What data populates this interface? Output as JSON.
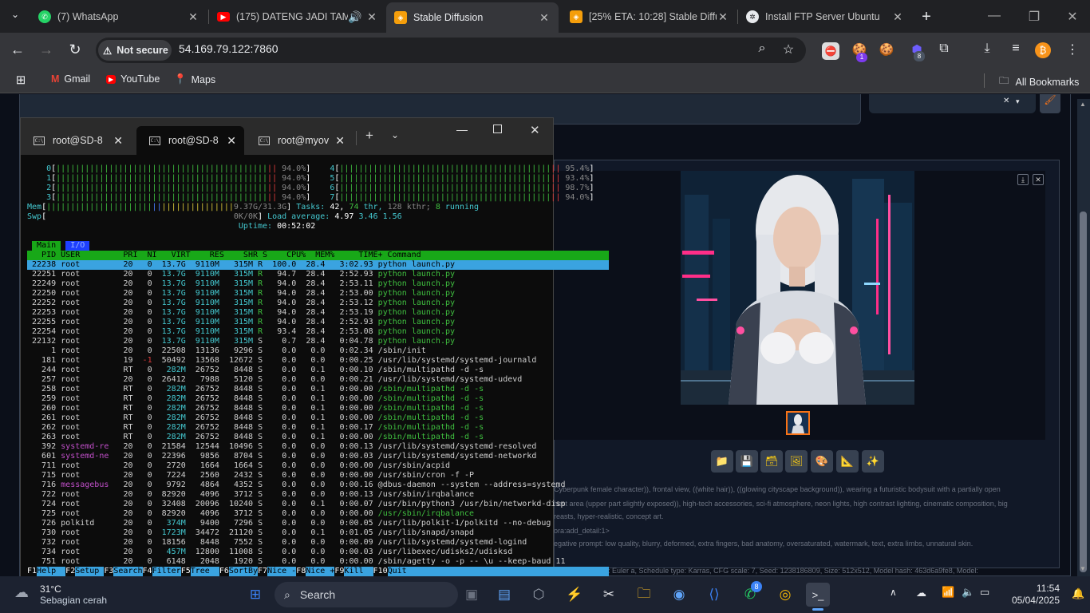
{
  "browser": {
    "tabs": [
      {
        "title": "(7) WhatsApp",
        "icon": "whatsapp-icon",
        "active": false
      },
      {
        "title": "(175) DATENG JADI TAMU",
        "icon": "youtube-icon",
        "active": false
      },
      {
        "title": "Stable Diffusion",
        "icon": "stable-diffusion-icon",
        "active": true
      },
      {
        "title": "[25% ETA: 10:28] Stable Diffu",
        "icon": "stable-diffusion-icon",
        "active": false
      },
      {
        "title": "Install FTP Server Ubuntu",
        "icon": "chatgpt-icon",
        "active": false
      }
    ],
    "security_label": "Not secure",
    "url": "54.169.79.122:7860",
    "bookmarks": [
      "Gmail",
      "YouTube",
      "Maps"
    ],
    "all_bookmarks_label": "All Bookmarks",
    "extension_badges": {
      "ext1": "1",
      "ext2": "8"
    }
  },
  "terminal": {
    "tabs": [
      "root@SD-8",
      "root@SD-8",
      "root@myov"
    ],
    "active_tab": 1,
    "htop": {
      "cpus": [
        {
          "id": "0",
          "pct": "94.0%"
        },
        {
          "id": "1",
          "pct": "94.0%"
        },
        {
          "id": "2",
          "pct": "94.0%"
        },
        {
          "id": "3",
          "pct": "94.0%"
        },
        {
          "id": "4",
          "pct": "95.4%"
        },
        {
          "id": "5",
          "pct": "93.4%"
        },
        {
          "id": "6",
          "pct": "98.7%"
        },
        {
          "id": "7",
          "pct": "94.0%"
        }
      ],
      "mem": "9.37G/31.3G",
      "swp": "0K/0K",
      "tasks_label": "Tasks:",
      "tasks": "42,",
      "thr": "74",
      "thr_label": "thr,",
      "kthr": "128 kthr;",
      "running": "8",
      "running_label": "running",
      "load_label": "Load average:",
      "load1": "4.97",
      "load5": "3.46",
      "load15": "1.56",
      "uptime_label": "Uptime:",
      "uptime": "00:52:02",
      "view_tabs": [
        "Main",
        "I/O"
      ],
      "columns": [
        "PID",
        "USER",
        "PRI",
        "NI",
        "VIRT",
        "RES",
        "SHR",
        "S",
        "CPU%",
        "MEM%",
        "TIME+",
        "Command"
      ],
      "processes": [
        [
          "22238",
          "root",
          "20",
          "0",
          "13.7G",
          "9110M",
          "315M",
          "R",
          "100.0",
          "28.4",
          "3:02.93",
          "python launch.py"
        ],
        [
          "22251",
          "root",
          "20",
          "0",
          "13.7G",
          "9110M",
          "315M",
          "R",
          "94.7",
          "28.4",
          "2:52.93",
          "python launch.py"
        ],
        [
          "22249",
          "root",
          "20",
          "0",
          "13.7G",
          "9110M",
          "315M",
          "R",
          "94.0",
          "28.4",
          "2:53.11",
          "python launch.py"
        ],
        [
          "22250",
          "root",
          "20",
          "0",
          "13.7G",
          "9110M",
          "315M",
          "R",
          "94.0",
          "28.4",
          "2:53.00",
          "python launch.py"
        ],
        [
          "22252",
          "root",
          "20",
          "0",
          "13.7G",
          "9110M",
          "315M",
          "R",
          "94.0",
          "28.4",
          "2:53.12",
          "python launch.py"
        ],
        [
          "22253",
          "root",
          "20",
          "0",
          "13.7G",
          "9110M",
          "315M",
          "R",
          "94.0",
          "28.4",
          "2:53.19",
          "python launch.py"
        ],
        [
          "22255",
          "root",
          "20",
          "0",
          "13.7G",
          "9110M",
          "315M",
          "R",
          "94.0",
          "28.4",
          "2:52.93",
          "python launch.py"
        ],
        [
          "22254",
          "root",
          "20",
          "0",
          "13.7G",
          "9110M",
          "315M",
          "R",
          "93.4",
          "28.4",
          "2:53.08",
          "python launch.py"
        ],
        [
          "22132",
          "root",
          "20",
          "0",
          "13.7G",
          "9110M",
          "315M",
          "S",
          "0.7",
          "28.4",
          "0:04.78",
          "python launch.py"
        ],
        [
          "1",
          "root",
          "20",
          "0",
          "22508",
          "13136",
          "9296",
          "S",
          "0.0",
          "0.0",
          "0:02.34",
          "/sbin/init"
        ],
        [
          "181",
          "root",
          "19",
          "-1",
          "50492",
          "13568",
          "12672",
          "S",
          "0.0",
          "0.0",
          "0:00.25",
          "/usr/lib/systemd/systemd-journald"
        ],
        [
          "244",
          "root",
          "RT",
          "0",
          "282M",
          "26752",
          "8448",
          "S",
          "0.0",
          "0.1",
          "0:00.10",
          "/sbin/multipathd -d -s"
        ],
        [
          "257",
          "root",
          "20",
          "0",
          "26412",
          "7988",
          "5120",
          "S",
          "0.0",
          "0.0",
          "0:00.21",
          "/usr/lib/systemd/systemd-udevd"
        ],
        [
          "258",
          "root",
          "RT",
          "0",
          "282M",
          "26752",
          "8448",
          "S",
          "0.0",
          "0.1",
          "0:00.00",
          "/sbin/multipathd -d -s"
        ],
        [
          "259",
          "root",
          "RT",
          "0",
          "282M",
          "26752",
          "8448",
          "S",
          "0.0",
          "0.1",
          "0:00.00",
          "/sbin/multipathd -d -s"
        ],
        [
          "260",
          "root",
          "RT",
          "0",
          "282M",
          "26752",
          "8448",
          "S",
          "0.0",
          "0.1",
          "0:00.00",
          "/sbin/multipathd -d -s"
        ],
        [
          "261",
          "root",
          "RT",
          "0",
          "282M",
          "26752",
          "8448",
          "S",
          "0.0",
          "0.1",
          "0:00.00",
          "/sbin/multipathd -d -s"
        ],
        [
          "262",
          "root",
          "RT",
          "0",
          "282M",
          "26752",
          "8448",
          "S",
          "0.0",
          "0.1",
          "0:00.17",
          "/sbin/multipathd -d -s"
        ],
        [
          "263",
          "root",
          "RT",
          "0",
          "282M",
          "26752",
          "8448",
          "S",
          "0.0",
          "0.1",
          "0:00.00",
          "/sbin/multipathd -d -s"
        ],
        [
          "392",
          "systemd-re",
          "20",
          "0",
          "21584",
          "12544",
          "10496",
          "S",
          "0.0",
          "0.0",
          "0:00.13",
          "/usr/lib/systemd/systemd-resolved"
        ],
        [
          "601",
          "systemd-ne",
          "20",
          "0",
          "22396",
          "9856",
          "8704",
          "S",
          "0.0",
          "0.0",
          "0:00.03",
          "/usr/lib/systemd/systemd-networkd"
        ],
        [
          "711",
          "root",
          "20",
          "0",
          "2720",
          "1664",
          "1664",
          "S",
          "0.0",
          "0.0",
          "0:00.00",
          "/usr/sbin/acpid"
        ],
        [
          "715",
          "root",
          "20",
          "0",
          "7224",
          "2560",
          "2432",
          "S",
          "0.0",
          "0.0",
          "0:00.00",
          "/usr/sbin/cron -f -P"
        ],
        [
          "716",
          "messagebus",
          "20",
          "0",
          "9792",
          "4864",
          "4352",
          "S",
          "0.0",
          "0.0",
          "0:00.16",
          "@dbus-daemon --system --address=systemd"
        ],
        [
          "722",
          "root",
          "20",
          "0",
          "82920",
          "4096",
          "3712",
          "S",
          "0.0",
          "0.0",
          "0:00.13",
          "/usr/sbin/irqbalance"
        ],
        [
          "724",
          "root",
          "20",
          "0",
          "32408",
          "20096",
          "10240",
          "S",
          "0.0",
          "0.1",
          "0:00.07",
          "/usr/bin/python3 /usr/bin/networkd-disp"
        ],
        [
          "725",
          "root",
          "20",
          "0",
          "82920",
          "4096",
          "3712",
          "S",
          "0.0",
          "0.0",
          "0:00.00",
          "/usr/sbin/irqbalance"
        ],
        [
          "726",
          "polkitd",
          "20",
          "0",
          "374M",
          "9400",
          "7296",
          "S",
          "0.0",
          "0.0",
          "0:00.05",
          "/usr/lib/polkit-1/polkitd --no-debug"
        ],
        [
          "730",
          "root",
          "20",
          "0",
          "1723M",
          "34472",
          "21120",
          "S",
          "0.0",
          "0.1",
          "0:01.05",
          "/usr/lib/snapd/snapd"
        ],
        [
          "732",
          "root",
          "20",
          "0",
          "18156",
          "8448",
          "7552",
          "S",
          "0.0",
          "0.0",
          "0:00.09",
          "/usr/lib/systemd/systemd-logind"
        ],
        [
          "734",
          "root",
          "20",
          "0",
          "457M",
          "12800",
          "11008",
          "S",
          "0.0",
          "0.0",
          "0:00.03",
          "/usr/libexec/udisks2/udisksd"
        ],
        [
          "751",
          "root",
          "20",
          "0",
          "6148",
          "2048",
          "1920",
          "S",
          "0.0",
          "0.0",
          "0:00.00",
          "/sbin/agetty -o -p -- \\u --keep-baud 11"
        ]
      ],
      "fkeys": [
        [
          "F1",
          "Help"
        ],
        [
          "F2",
          "Setup"
        ],
        [
          "F3",
          "Search"
        ],
        [
          "F4",
          "Filter"
        ],
        [
          "F5",
          "Tree"
        ],
        [
          "F6",
          "SortBy"
        ],
        [
          "F7",
          "Nice -"
        ],
        [
          "F8",
          "Nice +"
        ],
        [
          "F9",
          "Kill"
        ],
        [
          "F10",
          "Quit"
        ]
      ]
    }
  },
  "webui": {
    "info_lines": [
      "Cyberpunk female character)), frontal view, ((white hair)), ((glowing cityscape background)), wearing a futuristic bodysuit with a partially open",
      "hest area (upper part slightly exposed)), high-tech accessories, sci-fi atmosphere, neon lights, high contrast lighting, cinematic composition, big",
      "reasts, hyper-realistic, concept art.",
      "ora:add_detail:1>",
      "egative prompt: low quality, blurry, deformed, extra fingers, bad anatomy, oversaturated, watermark, text, extra limbs, unnatural skin.",
      "",
      "eps: 20, Sampler: Euler a, Schedule type: Karras, CFG scale: 7, Seed: 1238186809, Size: 512x512, Model hash: 463d6a9fe8, Model:"
    ],
    "gallery_buttons": [
      "folder-icon",
      "save-icon",
      "zip-icon",
      "image-icon",
      "palette-icon",
      "ruler-icon",
      "sparkle-icon"
    ]
  },
  "taskbar": {
    "weather_temp": "31°C",
    "weather_desc": "Sebagian cerah",
    "search_placeholder": "Search",
    "time": "11:54",
    "date": "05/04/2025",
    "badges": {
      "whatsapp": "8"
    }
  }
}
